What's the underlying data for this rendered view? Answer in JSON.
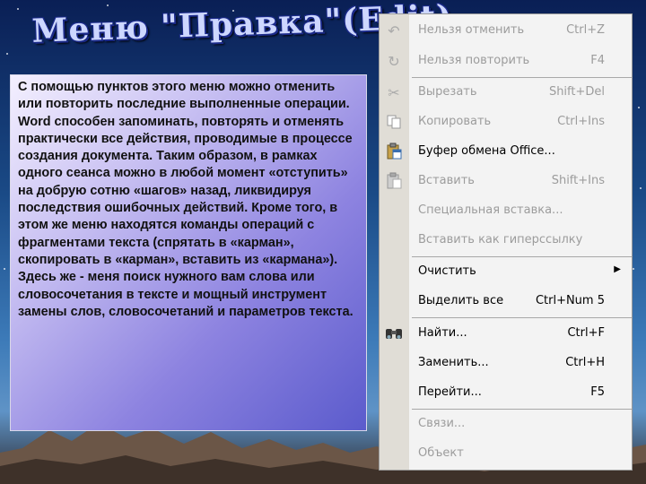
{
  "slide_title": "Меню \"Правка\"(Edit)",
  "description": "С помощью пунктов этого меню можно отменить или повторить последние выполненные операции. Word способен запоминать, повторять и отменять практически все действия, проводимые в процессе создания документа. Таким образом, в рамках одного сеанса можно в любой момент «отступить» на добрую сотню «шагов» назад, ликвидируя последствия ошибочных действий. Кроме того, в этом же меню находятся команды операций с фрагментами текста (спрятать в «карман», скопировать в «карман», вставить из «кармана»). Здесь же - меня поиск нужного вам слова или словосочетания в тексте и мощный инструмент замены слов, словосочетаний и параметров текста.",
  "menu": {
    "items": [
      {
        "label": "Нельзя отменить",
        "shortcut": "Ctrl+Z",
        "icon": "undo-icon",
        "enabled": false
      },
      {
        "label": "Нельзя повторить",
        "shortcut": "F4",
        "icon": "redo-icon",
        "enabled": false
      },
      {
        "label": "Вырезать",
        "shortcut": "Shift+Del",
        "icon": "scissors-icon",
        "enabled": false
      },
      {
        "label": "Копировать",
        "shortcut": "Ctrl+Ins",
        "icon": "copy-icon",
        "enabled": false
      },
      {
        "label": "Буфер обмена Office...",
        "shortcut": "",
        "icon": "clipboard-icon",
        "enabled": true
      },
      {
        "label": "Вставить",
        "shortcut": "Shift+Ins",
        "icon": "paste-icon",
        "enabled": false
      },
      {
        "label": "Специальная вставка...",
        "shortcut": "",
        "icon": "",
        "enabled": false
      },
      {
        "label": "Вставить как гиперссылку",
        "shortcut": "",
        "icon": "",
        "enabled": false
      },
      {
        "label": "Очистить",
        "shortcut": "",
        "icon": "",
        "enabled": true,
        "submenu": true
      },
      {
        "label": "Выделить все",
        "shortcut": "Ctrl+Num 5",
        "icon": "",
        "enabled": true
      },
      {
        "label": "Найти...",
        "shortcut": "Ctrl+F",
        "icon": "binoculars-icon",
        "enabled": true
      },
      {
        "label": "Заменить...",
        "shortcut": "Ctrl+H",
        "icon": "",
        "enabled": true
      },
      {
        "label": "Перейти...",
        "shortcut": "F5",
        "icon": "",
        "enabled": true
      },
      {
        "label": "Связи...",
        "shortcut": "",
        "icon": "",
        "enabled": false
      },
      {
        "label": "Объект",
        "shortcut": "",
        "icon": "",
        "enabled": false
      }
    ]
  }
}
